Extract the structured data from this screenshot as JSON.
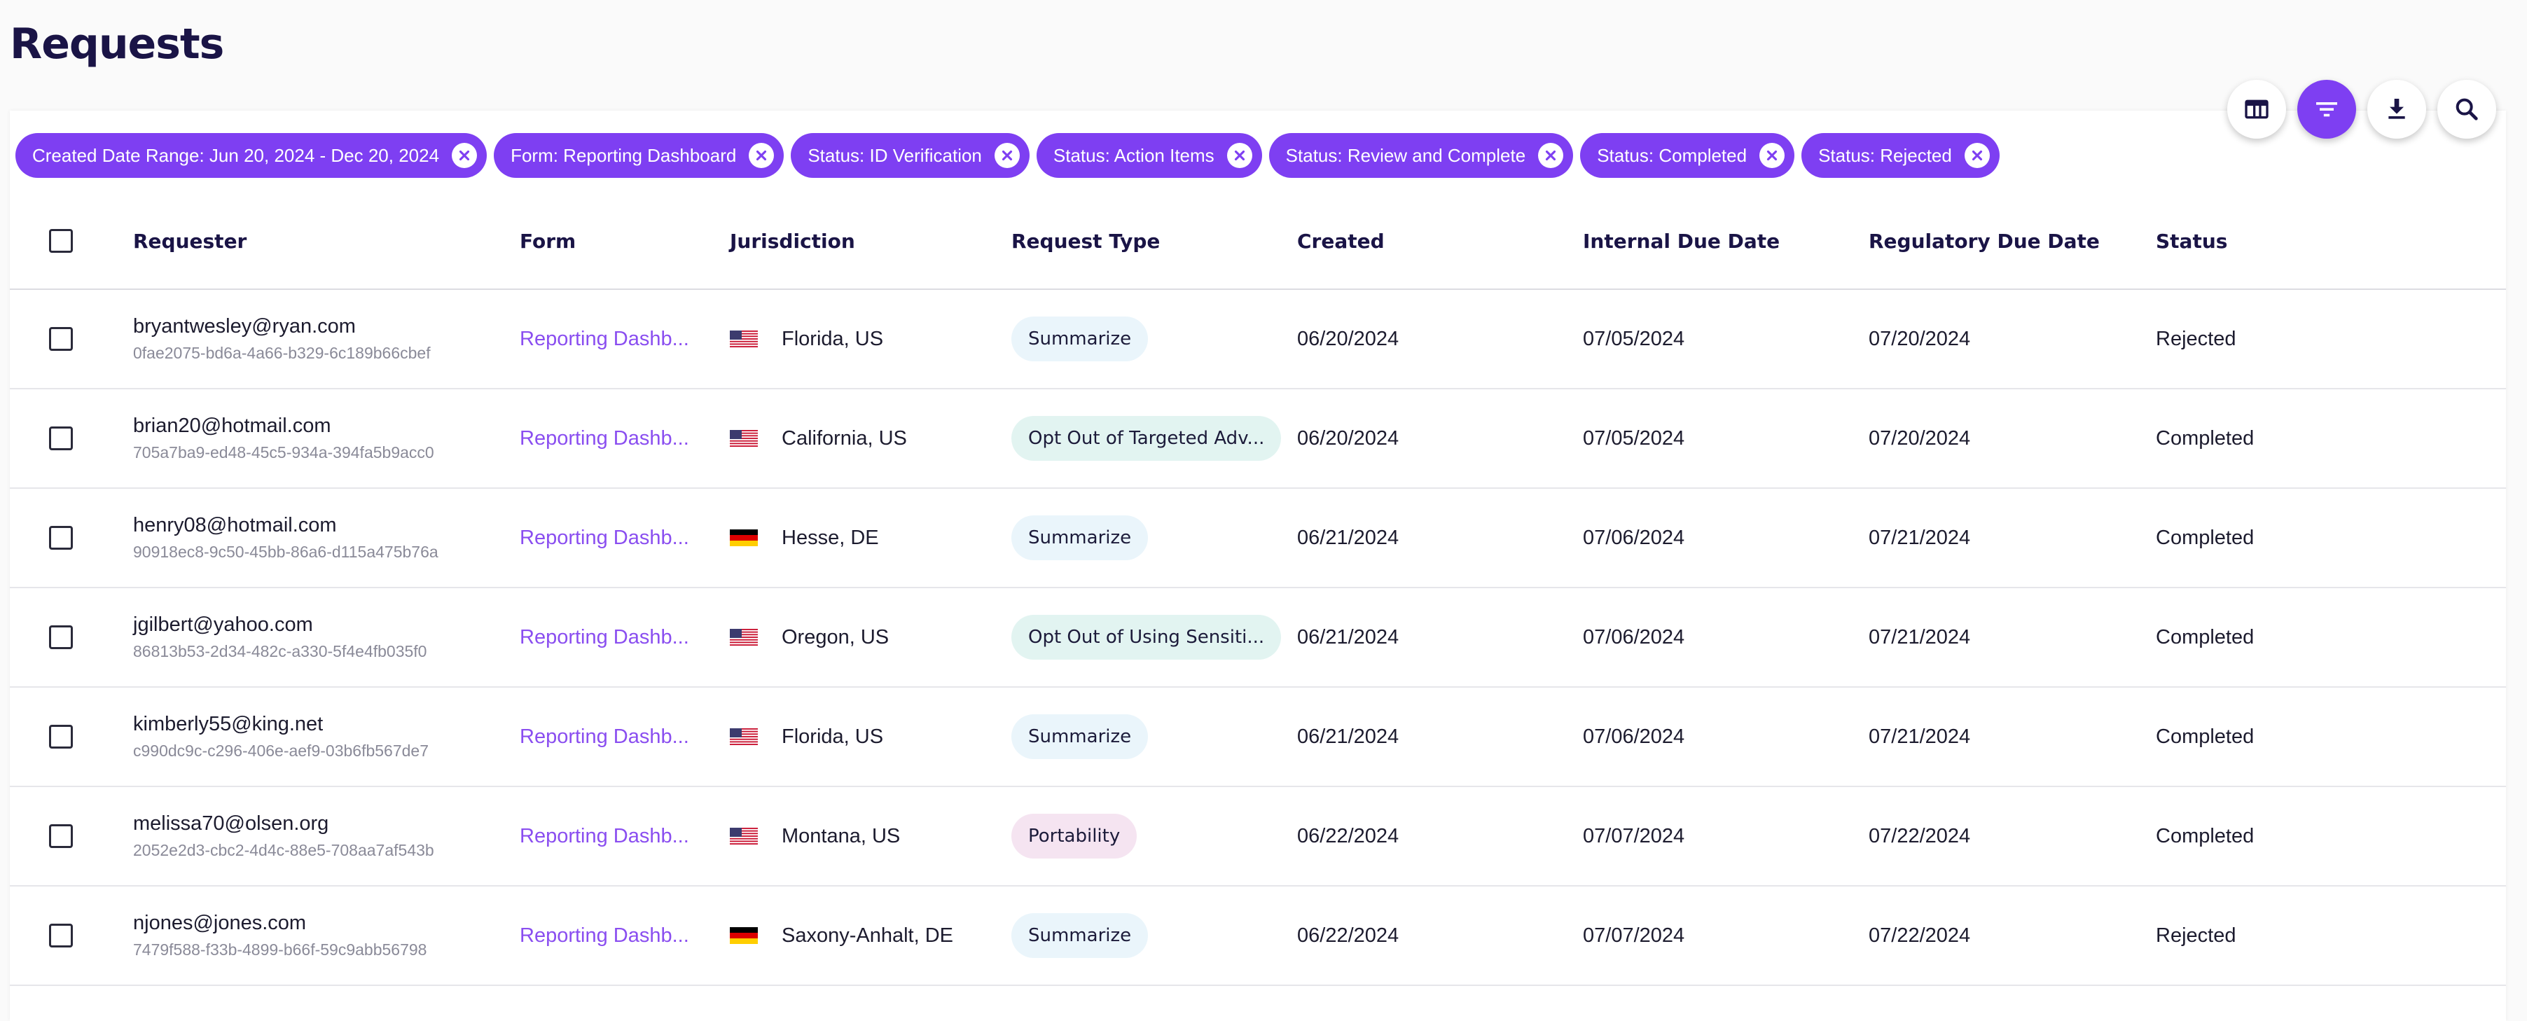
{
  "page": {
    "title": "Requests"
  },
  "toolbar": {
    "buttons": [
      {
        "name": "columns-button",
        "icon": "table-columns-icon"
      },
      {
        "name": "filter-button",
        "icon": "filter-icon",
        "active": true
      },
      {
        "name": "download-button",
        "icon": "download-icon"
      },
      {
        "name": "search-button",
        "icon": "search-icon"
      }
    ]
  },
  "filters": [
    "Created Date Range: Jun 20, 2024 - Dec 20, 2024",
    "Form: Reporting Dashboard",
    "Status: ID Verification",
    "Status: Action Items",
    "Status: Review and Complete",
    "Status: Completed",
    "Status: Rejected"
  ],
  "table": {
    "headers": {
      "requester": "Requester",
      "form": "Form",
      "jurisdiction": "Jurisdiction",
      "request_type": "Request Type",
      "created": "Created",
      "internal_due": "Internal Due Date",
      "regulatory_due": "Regulatory Due Date",
      "status": "Status"
    },
    "rows": [
      {
        "email": "bryantwesley@ryan.com",
        "id": "0fae2075-bd6a-4a66-b329-6c189b66cbef",
        "form": "Reporting Dashb...",
        "country": "US",
        "jurisdiction": "Florida, US",
        "type": "Summarize",
        "type_style": "summarize",
        "created": "06/20/2024",
        "internal_due": "07/05/2024",
        "regulatory_due": "07/20/2024",
        "status": "Rejected"
      },
      {
        "email": "brian20@hotmail.com",
        "id": "705a7ba9-ed48-45c5-934a-394fa5b9acc0",
        "form": "Reporting Dashb...",
        "country": "US",
        "jurisdiction": "California, US",
        "type": "Opt Out of Targeted Adv...",
        "type_style": "optout",
        "created": "06/20/2024",
        "internal_due": "07/05/2024",
        "regulatory_due": "07/20/2024",
        "status": "Completed"
      },
      {
        "email": "henry08@hotmail.com",
        "id": "90918ec8-9c50-45bb-86a6-d115a475b76a",
        "form": "Reporting Dashb...",
        "country": "DE",
        "jurisdiction": "Hesse, DE",
        "type": "Summarize",
        "type_style": "summarize",
        "created": "06/21/2024",
        "internal_due": "07/06/2024",
        "regulatory_due": "07/21/2024",
        "status": "Completed"
      },
      {
        "email": "jgilbert@yahoo.com",
        "id": "86813b53-2d34-482c-a330-5f4e4fb035f0",
        "form": "Reporting Dashb...",
        "country": "US",
        "jurisdiction": "Oregon, US",
        "type": "Opt Out of Using Sensiti...",
        "type_style": "optout",
        "created": "06/21/2024",
        "internal_due": "07/06/2024",
        "regulatory_due": "07/21/2024",
        "status": "Completed"
      },
      {
        "email": "kimberly55@king.net",
        "id": "c990dc9c-c296-406e-aef9-03b6fb567de7",
        "form": "Reporting Dashb...",
        "country": "US",
        "jurisdiction": "Florida, US",
        "type": "Summarize",
        "type_style": "summarize",
        "created": "06/21/2024",
        "internal_due": "07/06/2024",
        "regulatory_due": "07/21/2024",
        "status": "Completed"
      },
      {
        "email": "melissa70@olsen.org",
        "id": "2052e2d3-cbc2-4d4c-88e5-708aa7af543b",
        "form": "Reporting Dashb...",
        "country": "US",
        "jurisdiction": "Montana, US",
        "type": "Portability",
        "type_style": "portability",
        "created": "06/22/2024",
        "internal_due": "07/07/2024",
        "regulatory_due": "07/22/2024",
        "status": "Completed"
      },
      {
        "email": "njones@jones.com",
        "id": "7479f588-f33b-4899-b66f-59c9abb56798",
        "form": "Reporting Dashb...",
        "country": "DE",
        "jurisdiction": "Saxony-Anhalt, DE",
        "type": "Summarize",
        "type_style": "summarize",
        "created": "06/22/2024",
        "internal_due": "07/07/2024",
        "regulatory_due": "07/22/2024",
        "status": "Rejected"
      }
    ]
  },
  "colors": {
    "accent": "#7e3ff2",
    "link": "#8a4ef0",
    "title": "#1a1446"
  }
}
